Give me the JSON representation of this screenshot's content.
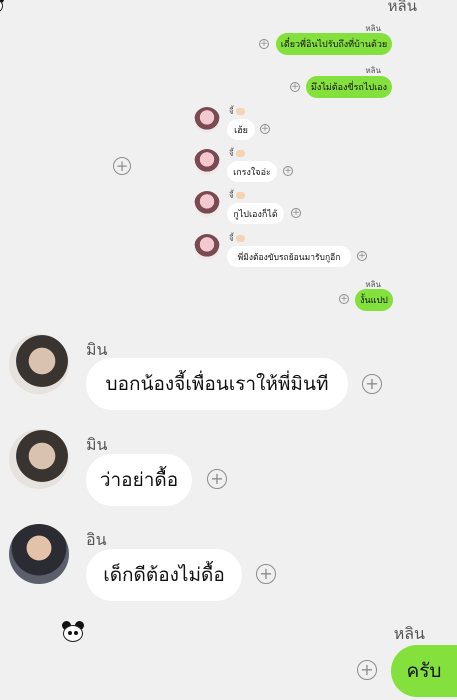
{
  "chat": {
    "top_cut_name": "หลิน",
    "top_bubbles": [
      {
        "sender": "หลิน",
        "text": "เดี๋ยวพี่อินไปรับถึงที่บ้านด้วย"
      },
      {
        "sender": "หลิน",
        "text": "มึงไม่ต้องขี่รถไปเอง"
      }
    ],
    "left_small_bubbles": [
      {
        "sender": "จี้",
        "text": "เฮ้ย"
      },
      {
        "sender": "จี้",
        "text": "เกรงใจอ่ะ"
      },
      {
        "sender": "จี้",
        "text": "กูไปเองก็ได้"
      },
      {
        "sender": "จี้",
        "text": "พี่มิงต้องขับรถย้อนมารับกูอีก"
      }
    ],
    "right_small_bubble": {
      "sender": "หลิน",
      "text": "งั้นแปป"
    },
    "big_messages": [
      {
        "sender": "มิน",
        "text": "บอกน้องจี้เพื่อนเราให้พี่มินที"
      },
      {
        "sender": "มิน",
        "text": "ว่าอย่าดื้อ"
      },
      {
        "sender": "อิน",
        "text": "เด็กดีต้องไม่ดื้อ"
      }
    ],
    "last_right": {
      "sender": "หลิน",
      "text": "ครับ"
    },
    "colors": {
      "background": "#f0f0f0",
      "outgoing": "#84e03c",
      "incoming": "#ffffff"
    },
    "icons": [
      "plus-circle-icon",
      "panda-emoji-icon",
      "hand-emoji-icon",
      "avatar"
    ]
  }
}
